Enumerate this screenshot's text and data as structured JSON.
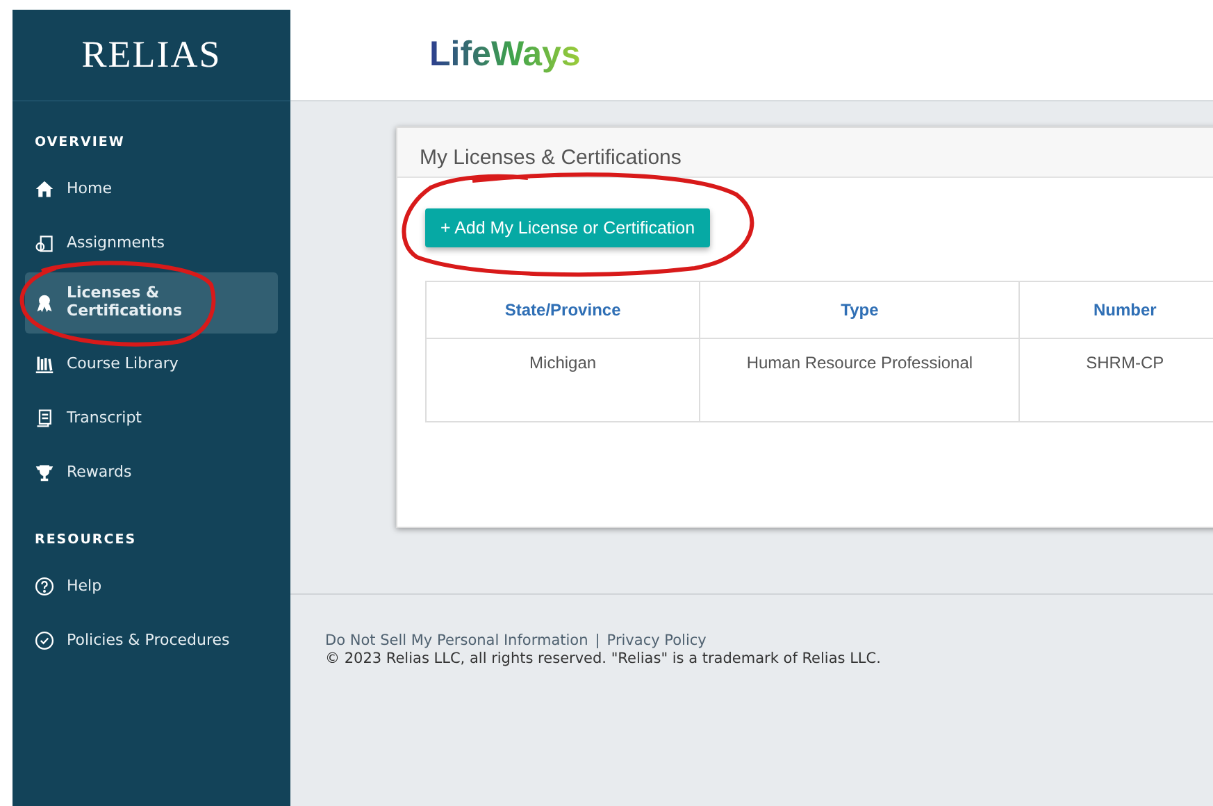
{
  "sidebar": {
    "logo": "RELIAS",
    "sections": [
      {
        "heading": "OVERVIEW",
        "items": [
          {
            "label": "Home",
            "selected": false
          },
          {
            "label": "Assignments",
            "selected": false
          },
          {
            "label": "Licenses & Certifications",
            "selected": true
          },
          {
            "label": "Course Library",
            "selected": false
          },
          {
            "label": "Transcript",
            "selected": false
          },
          {
            "label": "Rewards",
            "selected": false
          }
        ]
      },
      {
        "heading": "RESOURCES",
        "items": [
          {
            "label": "Help",
            "selected": false
          },
          {
            "label": "Policies & Procedures",
            "selected": false
          }
        ]
      }
    ]
  },
  "header": {
    "logo": "LifeWays"
  },
  "card": {
    "title": "My Licenses & Certifications",
    "add_button": "+ Add My License or Certification",
    "table": {
      "columns": [
        "State/Province",
        "Type",
        "Number"
      ],
      "rows": [
        [
          "Michigan",
          "Human Resource Professional",
          "SHRM-CP"
        ]
      ]
    }
  },
  "footer": {
    "links": [
      "Do Not Sell My Personal Information",
      "Privacy Policy"
    ],
    "separator": "|",
    "copyright": "© 2023 Relias LLC, all rights reserved. \"Relias\" is a trademark of Relias LLC."
  }
}
